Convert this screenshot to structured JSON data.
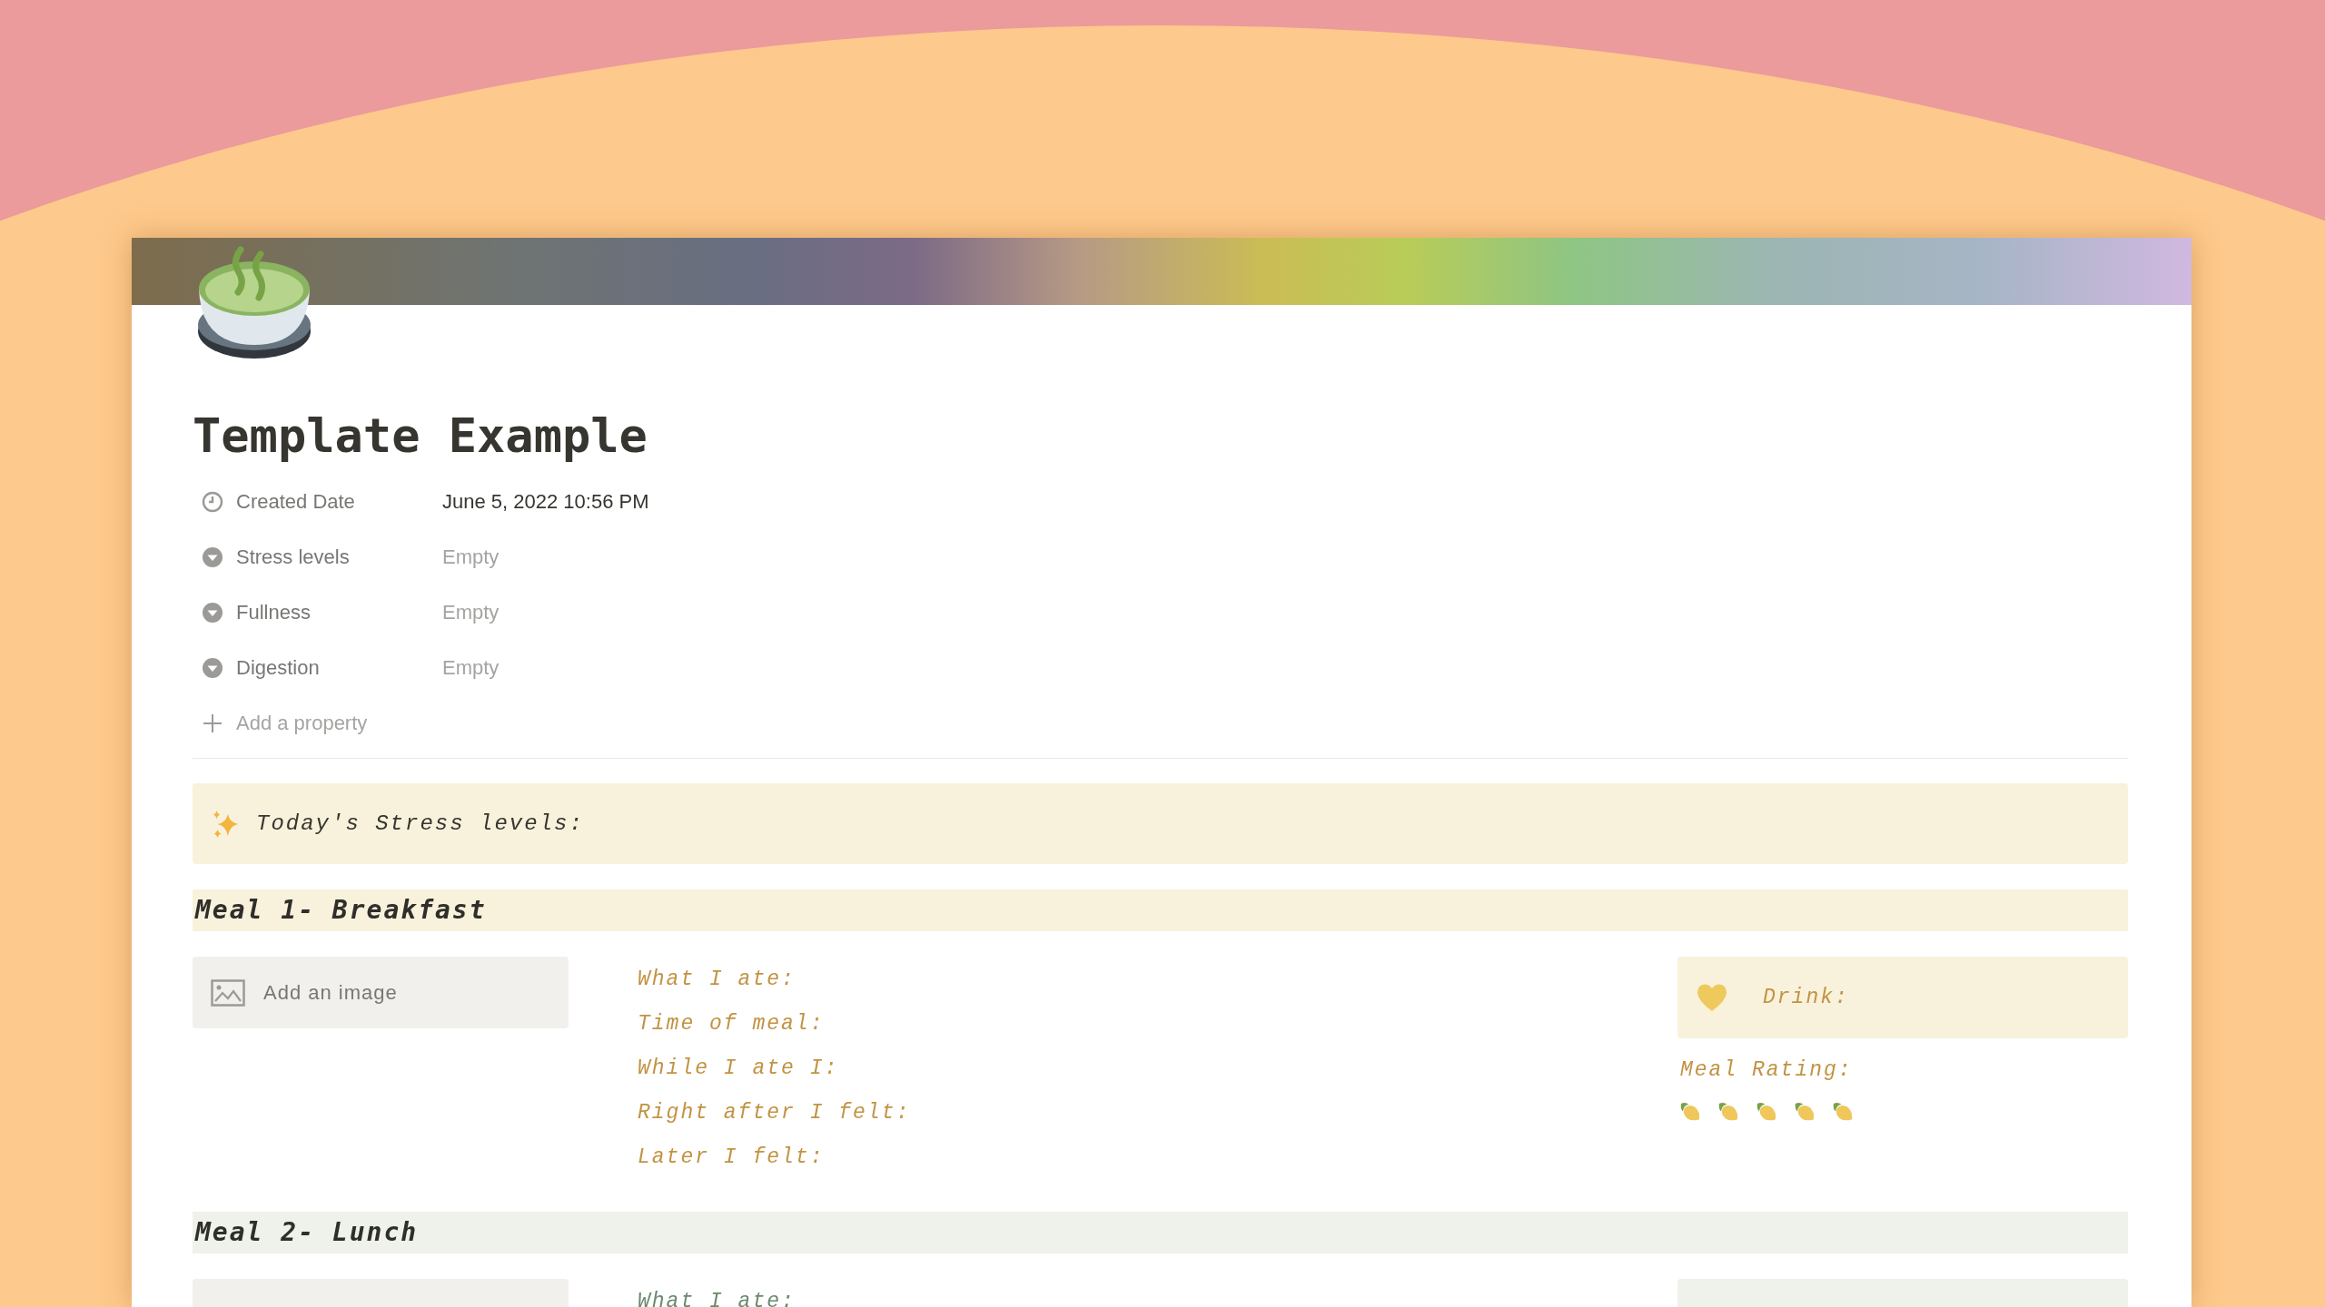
{
  "page": {
    "title": "Template Example",
    "properties": [
      {
        "kind": "date",
        "label": "Created Date",
        "value": "June 5, 2022 10:56 PM",
        "empty": false
      },
      {
        "kind": "select",
        "label": "Stress levels",
        "value": "Empty",
        "empty": true
      },
      {
        "kind": "select",
        "label": "Fullness",
        "value": "Empty",
        "empty": true
      },
      {
        "kind": "select",
        "label": "Digestion",
        "value": "Empty",
        "empty": true
      }
    ],
    "add_property": "Add a property"
  },
  "callout": {
    "text": "Today's Stress levels:"
  },
  "meals": [
    {
      "kind": "yellow",
      "heading": "Meal 1- Breakfast",
      "image_placeholder": "Add an image",
      "prompts": [
        "What I ate:",
        "Time of meal:",
        "While I ate I:",
        "Right after I felt:",
        "Later I felt:"
      ],
      "drink": "Drink:",
      "rating_label": "Meal Rating:",
      "stars": 5
    },
    {
      "kind": "green",
      "heading": "Meal 2- Lunch",
      "prompts": [
        "What I ate:"
      ]
    }
  ]
}
